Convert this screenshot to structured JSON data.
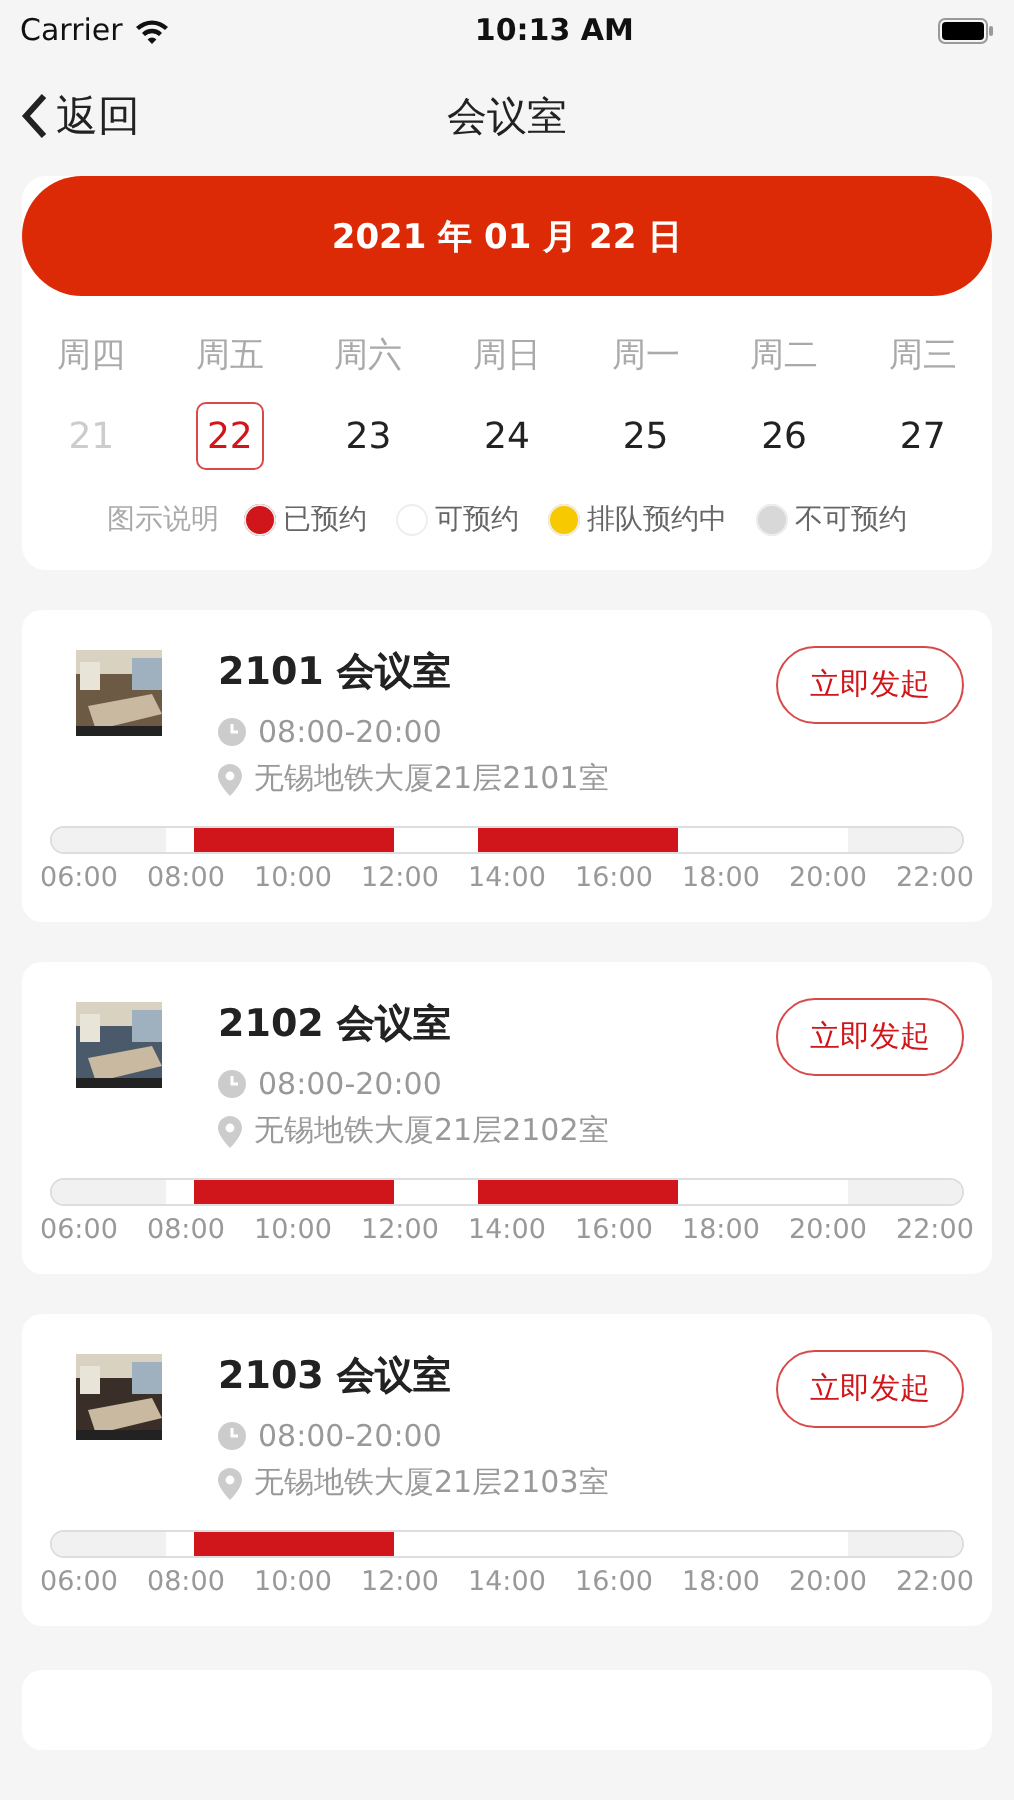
{
  "status_bar": {
    "carrier": "Carrier",
    "time": "10:13 AM"
  },
  "nav": {
    "back": "返回",
    "title": "会议室"
  },
  "date_bar": {
    "label": "2021 年 01 月 22 日"
  },
  "week": [
    {
      "weekday": "周四",
      "day": "21",
      "selected": false,
      "disabled": true
    },
    {
      "weekday": "周五",
      "day": "22",
      "selected": true,
      "disabled": false
    },
    {
      "weekday": "周六",
      "day": "23",
      "selected": false,
      "disabled": false
    },
    {
      "weekday": "周日",
      "day": "24",
      "selected": false,
      "disabled": false
    },
    {
      "weekday": "周一",
      "day": "25",
      "selected": false,
      "disabled": false
    },
    {
      "weekday": "周二",
      "day": "26",
      "selected": false,
      "disabled": false
    },
    {
      "weekday": "周三",
      "day": "27",
      "selected": false,
      "disabled": false
    }
  ],
  "legend": {
    "title": "图示说明",
    "items": [
      {
        "label": "已预约",
        "color": "#d0161b"
      },
      {
        "label": "可预约",
        "color": "#ffffff"
      },
      {
        "label": "排队预约中",
        "color": "#f7c900"
      },
      {
        "label": "不可预约",
        "color": "#d8d8d8"
      }
    ]
  },
  "rooms": [
    {
      "name": "2101 会议室",
      "hours": "08:00-20:00",
      "location": "无锡地铁大厦21层2101室",
      "button": "立即发起",
      "slots": [
        {
          "kind": "unavailable"
        },
        {
          "kind": "unavailable"
        },
        {
          "kind": "unavailable"
        },
        {
          "kind": "unavailable"
        },
        {
          "kind": "free"
        },
        {
          "kind": "booked"
        },
        {
          "kind": "booked"
        },
        {
          "kind": "booked"
        },
        {
          "kind": "booked"
        },
        {
          "kind": "booked"
        },
        {
          "kind": "booked"
        },
        {
          "kind": "booked"
        },
        {
          "kind": "free"
        },
        {
          "kind": "free"
        },
        {
          "kind": "free"
        },
        {
          "kind": "booked"
        },
        {
          "kind": "booked"
        },
        {
          "kind": "booked"
        },
        {
          "kind": "booked"
        },
        {
          "kind": "booked"
        },
        {
          "kind": "booked"
        },
        {
          "kind": "booked"
        },
        {
          "kind": "free"
        },
        {
          "kind": "free"
        },
        {
          "kind": "free"
        },
        {
          "kind": "free"
        },
        {
          "kind": "free"
        },
        {
          "kind": "free"
        },
        {
          "kind": "unavailable"
        },
        {
          "kind": "unavailable"
        },
        {
          "kind": "unavailable"
        },
        {
          "kind": "unavailable"
        }
      ],
      "ticks": [
        "06:00",
        "08:00",
        "10:00",
        "12:00",
        "14:00",
        "16:00",
        "18:00",
        "20:00",
        "22:00"
      ]
    },
    {
      "name": "2102 会议室",
      "hours": "08:00-20:00",
      "location": "无锡地铁大厦21层2102室",
      "button": "立即发起",
      "slots": [
        {
          "kind": "unavailable"
        },
        {
          "kind": "unavailable"
        },
        {
          "kind": "unavailable"
        },
        {
          "kind": "unavailable"
        },
        {
          "kind": "free"
        },
        {
          "kind": "booked"
        },
        {
          "kind": "booked"
        },
        {
          "kind": "booked"
        },
        {
          "kind": "booked"
        },
        {
          "kind": "booked"
        },
        {
          "kind": "booked"
        },
        {
          "kind": "booked"
        },
        {
          "kind": "free"
        },
        {
          "kind": "free"
        },
        {
          "kind": "free"
        },
        {
          "kind": "booked"
        },
        {
          "kind": "booked"
        },
        {
          "kind": "booked"
        },
        {
          "kind": "booked"
        },
        {
          "kind": "booked"
        },
        {
          "kind": "booked"
        },
        {
          "kind": "booked"
        },
        {
          "kind": "free"
        },
        {
          "kind": "free"
        },
        {
          "kind": "free"
        },
        {
          "kind": "free"
        },
        {
          "kind": "free"
        },
        {
          "kind": "free"
        },
        {
          "kind": "unavailable"
        },
        {
          "kind": "unavailable"
        },
        {
          "kind": "unavailable"
        },
        {
          "kind": "unavailable"
        }
      ],
      "ticks": [
        "06:00",
        "08:00",
        "10:00",
        "12:00",
        "14:00",
        "16:00",
        "18:00",
        "20:00",
        "22:00"
      ]
    },
    {
      "name": "2103 会议室",
      "hours": "08:00-20:00",
      "location": "无锡地铁大厦21层2103室",
      "button": "立即发起",
      "slots": [
        {
          "kind": "unavailable"
        },
        {
          "kind": "unavailable"
        },
        {
          "kind": "unavailable"
        },
        {
          "kind": "unavailable"
        },
        {
          "kind": "free"
        },
        {
          "kind": "booked"
        },
        {
          "kind": "booked"
        },
        {
          "kind": "booked"
        },
        {
          "kind": "booked"
        },
        {
          "kind": "booked"
        },
        {
          "kind": "booked"
        },
        {
          "kind": "booked"
        },
        {
          "kind": "free"
        },
        {
          "kind": "free"
        },
        {
          "kind": "free"
        },
        {
          "kind": "free"
        },
        {
          "kind": "free"
        },
        {
          "kind": "free"
        },
        {
          "kind": "free"
        },
        {
          "kind": "free"
        },
        {
          "kind": "free"
        },
        {
          "kind": "free"
        },
        {
          "kind": "free"
        },
        {
          "kind": "free"
        },
        {
          "kind": "free"
        },
        {
          "kind": "free"
        },
        {
          "kind": "free"
        },
        {
          "kind": "free"
        },
        {
          "kind": "unavailable"
        },
        {
          "kind": "unavailable"
        },
        {
          "kind": "unavailable"
        },
        {
          "kind": "unavailable"
        }
      ],
      "ticks": [
        "06:00",
        "08:00",
        "10:00",
        "12:00",
        "14:00",
        "16:00",
        "18:00",
        "20:00",
        "22:00"
      ]
    }
  ]
}
